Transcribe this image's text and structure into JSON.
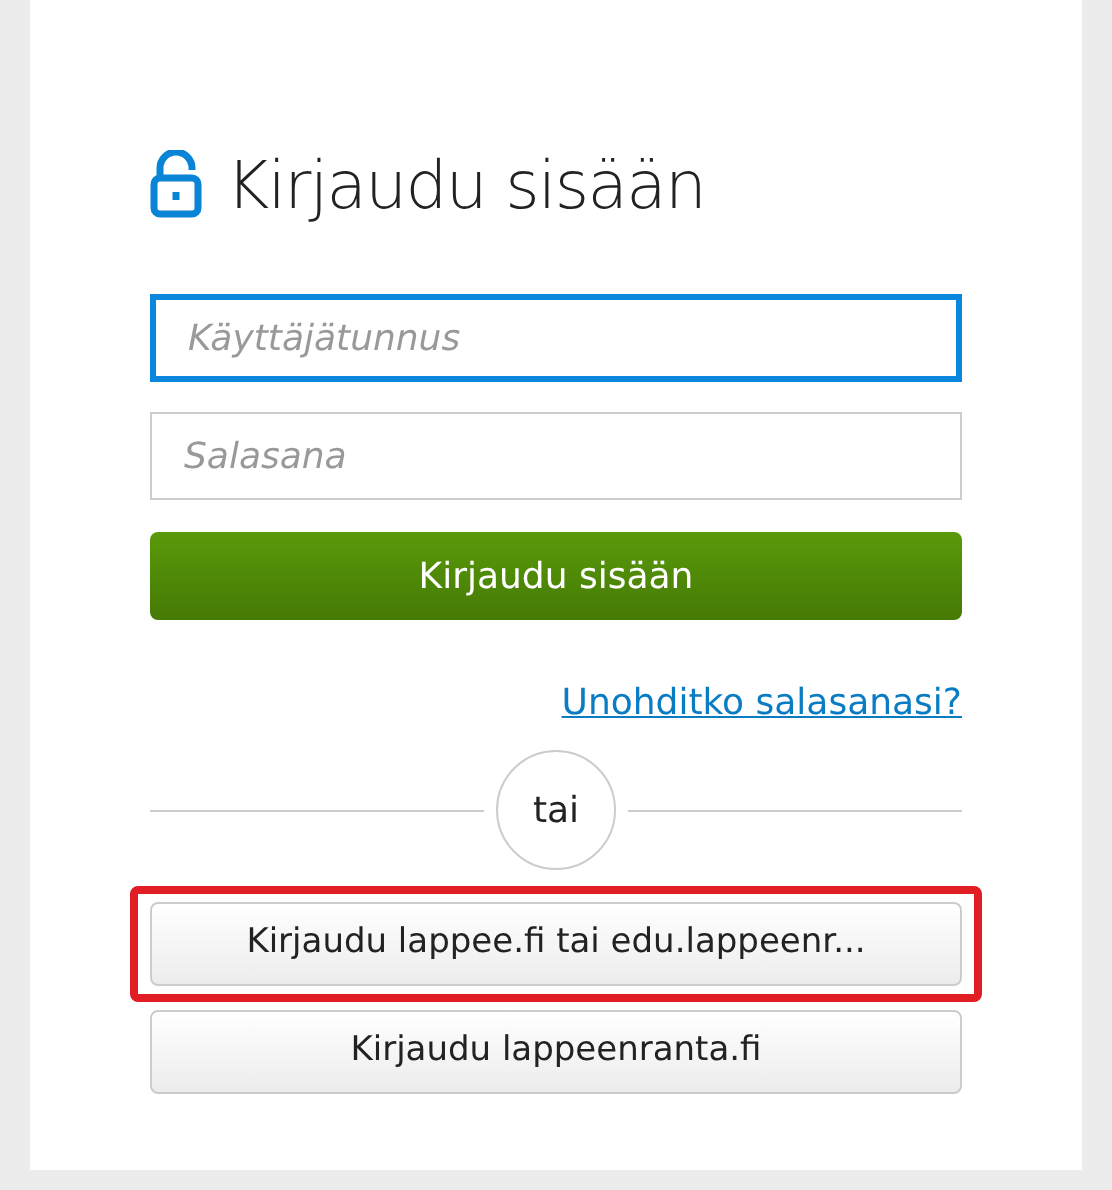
{
  "title": "Kirjaudu sisään",
  "fields": [
    {
      "placeholder": "Käyttäjätunnus",
      "focused": true
    },
    {
      "placeholder": "Salasana",
      "focused": false
    }
  ],
  "submit_button": "Kirjaudu sisään",
  "forgot_link": "Unohditko salasanasi?",
  "separator": "tai",
  "alt_buttons": [
    {
      "label": "Kirjaudu lappee.fi tai edu.lappeenr...",
      "highlighted": true
    },
    {
      "label": "Kirjaudu lappeenranta.fi",
      "highlighted": false
    }
  ]
}
